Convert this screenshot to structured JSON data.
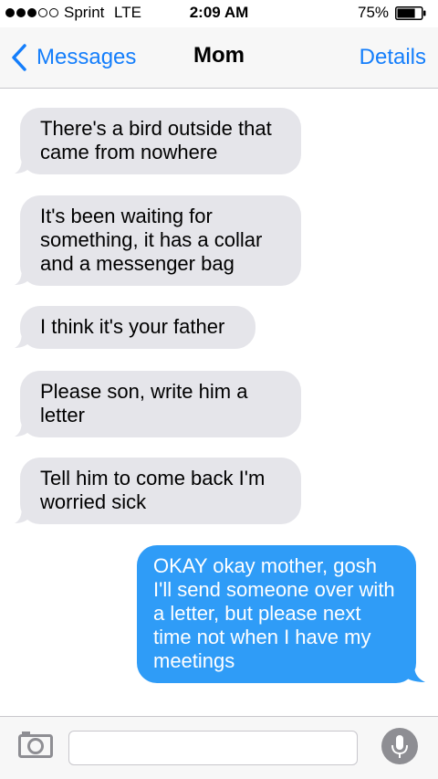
{
  "status": {
    "carrier": "Sprint",
    "network": "LTE",
    "time": "2:09 AM",
    "battery_percent": "75%",
    "battery_level": 0.75,
    "signal_bars_filled": 3,
    "signal_bars_total": 5
  },
  "nav": {
    "back_label": "Messages",
    "title": "Mom",
    "details_label": "Details"
  },
  "messages": [
    {
      "direction": "in",
      "text": "There's a bird outside that came from nowhere"
    },
    {
      "direction": "in",
      "text": "It's been waiting for something, it has a collar and a messenger bag"
    },
    {
      "direction": "in",
      "text": "I think it's your father"
    },
    {
      "direction": "in",
      "text": "Please son, write him a letter"
    },
    {
      "direction": "in",
      "text": "Tell him to come back I'm worried sick"
    },
    {
      "direction": "out",
      "text": "OKAY okay mother, gosh I'll send someone over with a letter, but please next time not when I have my meetings"
    }
  ],
  "composer": {
    "value": "",
    "placeholder": ""
  },
  "colors": {
    "accent": "#147efb",
    "incoming_bubble": "#e5e5ea",
    "outgoing_bubble": "#2f9cf7"
  }
}
